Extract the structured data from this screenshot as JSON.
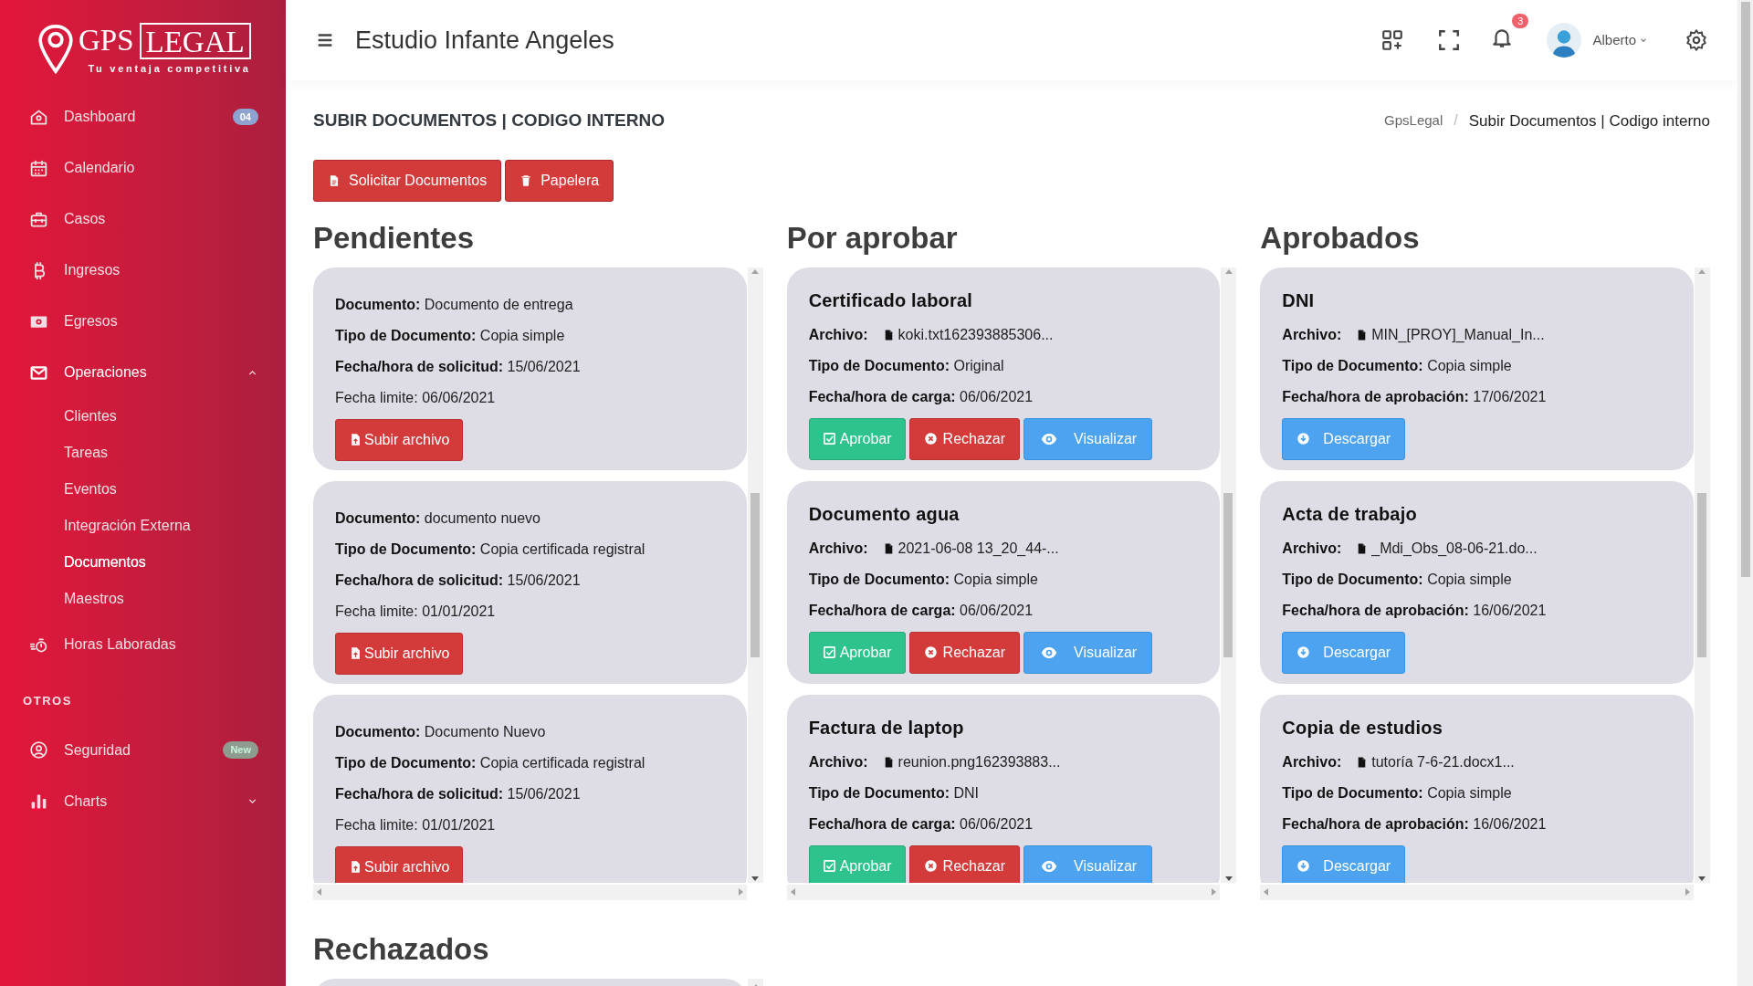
{
  "brand": {
    "name_left": "GPS",
    "name_right": "LEGAL",
    "tagline": "Tu ventaja competitiva"
  },
  "sidebar": {
    "items": [
      {
        "kind": "link",
        "label": "Dashboard",
        "badge": {
          "text": "04",
          "color": "#8fa3d1"
        }
      },
      {
        "kind": "link",
        "label": "Calendario"
      },
      {
        "kind": "link",
        "label": "Casos"
      },
      {
        "kind": "link",
        "label": "Ingresos"
      },
      {
        "kind": "link",
        "label": "Egresos"
      },
      {
        "kind": "group",
        "label": "Operaciones",
        "expanded": true,
        "children": [
          {
            "label": "Clientes",
            "selected": false
          },
          {
            "label": "Tareas",
            "selected": false
          },
          {
            "label": "Eventos",
            "selected": false
          },
          {
            "label": "Integración Externa",
            "selected": false
          },
          {
            "label": "Documentos",
            "selected": true
          },
          {
            "label": "Maestros",
            "selected": false
          }
        ]
      },
      {
        "kind": "link",
        "label": "Horas Laboradas"
      },
      {
        "kind": "heading",
        "label": "OTROS"
      },
      {
        "kind": "link",
        "label": "Seguridad",
        "badge": {
          "text": "New",
          "color": "#8e9b8f"
        }
      },
      {
        "kind": "group",
        "label": "Charts",
        "expanded": false
      }
    ]
  },
  "header": {
    "title": "Estudio Infante Angeles",
    "notifications": "3",
    "user": "Alberto"
  },
  "page": {
    "title": "SUBIR DOCUMENTOS | CODIGO INTERNO",
    "breadcrumb": [
      {
        "text": "GpsLegal",
        "current": false
      },
      {
        "text": "Subir Documentos | Codigo interno",
        "current": true
      }
    ],
    "separator": "/",
    "actions": [
      {
        "label": "Solicitar Documentos"
      },
      {
        "label": "Papelera"
      }
    ]
  },
  "columns": [
    {
      "title": "Pendientes",
      "cards": [
        {
          "lines": [
            {
              "kind": "text",
              "text": "**Documento:** Documento de entrega"
            },
            {
              "kind": "text",
              "text": "**Tipo de Documento:** Copia simple"
            },
            {
              "kind": "text",
              "text": "**Fecha/hora de solicitud:** 15/06/2021"
            },
            {
              "kind": "text",
              "text": "Fecha limite: 06/06/2021"
            }
          ],
          "buttons": [
            {
              "kind": "upload",
              "label": "Subir archivo"
            }
          ]
        },
        {
          "lines": [
            {
              "kind": "text",
              "text": "**Documento:** documento nuevo"
            },
            {
              "kind": "text",
              "text": "**Tipo de Documento:** Copia certificada registral"
            },
            {
              "kind": "text",
              "text": "**Fecha/hora de solicitud:** 15/06/2021"
            },
            {
              "kind": "text",
              "text": "Fecha limite: 01/01/2021"
            }
          ],
          "buttons": [
            {
              "kind": "upload",
              "label": "Subir archivo"
            }
          ]
        },
        {
          "lines": [
            {
              "kind": "text",
              "text": "**Documento:** Documento Nuevo"
            },
            {
              "kind": "text",
              "text": "**Tipo de Documento:** Copia certificada registral"
            },
            {
              "kind": "text",
              "text": "**Fecha/hora de solicitud:** 15/06/2021"
            },
            {
              "kind": "text",
              "text": "Fecha limite: 01/01/2021"
            }
          ],
          "buttons": [
            {
              "kind": "upload",
              "label": "Subir archivo"
            }
          ]
        }
      ]
    },
    {
      "title": "Por aprobar",
      "cards": [
        {
          "heading": "Certificado laboral",
          "lines": [
            {
              "kind": "file",
              "label": "Archivo:",
              "file": "koki.txt162393885306..."
            },
            {
              "kind": "text",
              "text": "**Tipo de Documento:** Original"
            },
            {
              "kind": "text",
              "text": "**Fecha/hora de carga:** 06/06/2021"
            }
          ],
          "buttons": [
            {
              "kind": "approve",
              "label": "Aprobar"
            },
            {
              "kind": "reject",
              "label": "Rechazar"
            },
            {
              "kind": "view",
              "label": "Visualizar"
            }
          ]
        },
        {
          "heading": "Documento agua",
          "lines": [
            {
              "kind": "file",
              "label": "Archivo:",
              "file": "2021-06-08 13_20_44-..."
            },
            {
              "kind": "text",
              "text": "**Tipo de Documento:** Copia simple"
            },
            {
              "kind": "text",
              "text": "**Fecha/hora de carga:** 06/06/2021"
            }
          ],
          "buttons": [
            {
              "kind": "approve",
              "label": "Aprobar"
            },
            {
              "kind": "reject",
              "label": "Rechazar"
            },
            {
              "kind": "view",
              "label": "Visualizar"
            }
          ]
        },
        {
          "heading": "Factura de laptop",
          "lines": [
            {
              "kind": "file",
              "label": "Archivo:",
              "file": "reunion.png162393883..."
            },
            {
              "kind": "text",
              "text": "**Tipo de Documento:** DNI"
            },
            {
              "kind": "text",
              "text": "**Fecha/hora de carga:** 06/06/2021"
            }
          ],
          "buttons": [
            {
              "kind": "approve",
              "label": "Aprobar"
            },
            {
              "kind": "reject",
              "label": "Rechazar"
            },
            {
              "kind": "view",
              "label": "Visualizar"
            }
          ]
        }
      ]
    },
    {
      "title": "Aprobados",
      "cards": [
        {
          "heading": "DNI",
          "lines": [
            {
              "kind": "file",
              "label": "Archivo:",
              "file": "MIN_[PROY]_Manual_In..."
            },
            {
              "kind": "text",
              "text": "**Tipo de Documento:** Copia simple"
            },
            {
              "kind": "text",
              "text": "**Fecha/hora de aprobación:** 17/06/2021"
            }
          ],
          "buttons": [
            {
              "kind": "download",
              "label": "Descargar"
            }
          ]
        },
        {
          "heading": "Acta de trabajo",
          "lines": [
            {
              "kind": "file",
              "label": "Archivo:",
              "file": "_Mdi_Obs_08-06-21.do..."
            },
            {
              "kind": "text",
              "text": "**Tipo de Documento:** Copia simple"
            },
            {
              "kind": "text",
              "text": "**Fecha/hora de aprobación:** 16/06/2021"
            }
          ],
          "buttons": [
            {
              "kind": "download",
              "label": "Descargar"
            }
          ]
        },
        {
          "heading": "Copia de estudios",
          "lines": [
            {
              "kind": "file",
              "label": "Archivo:",
              "file": "tutoría 7-6-21.docx1..."
            },
            {
              "kind": "text",
              "text": "**Tipo de Documento:** Copia simple"
            },
            {
              "kind": "text",
              "text": "**Fecha/hora de aprobación:** 16/06/2021"
            }
          ],
          "buttons": [
            {
              "kind": "download",
              "label": "Descargar"
            }
          ]
        }
      ]
    }
  ],
  "rejected": {
    "title": "Rechazados"
  }
}
